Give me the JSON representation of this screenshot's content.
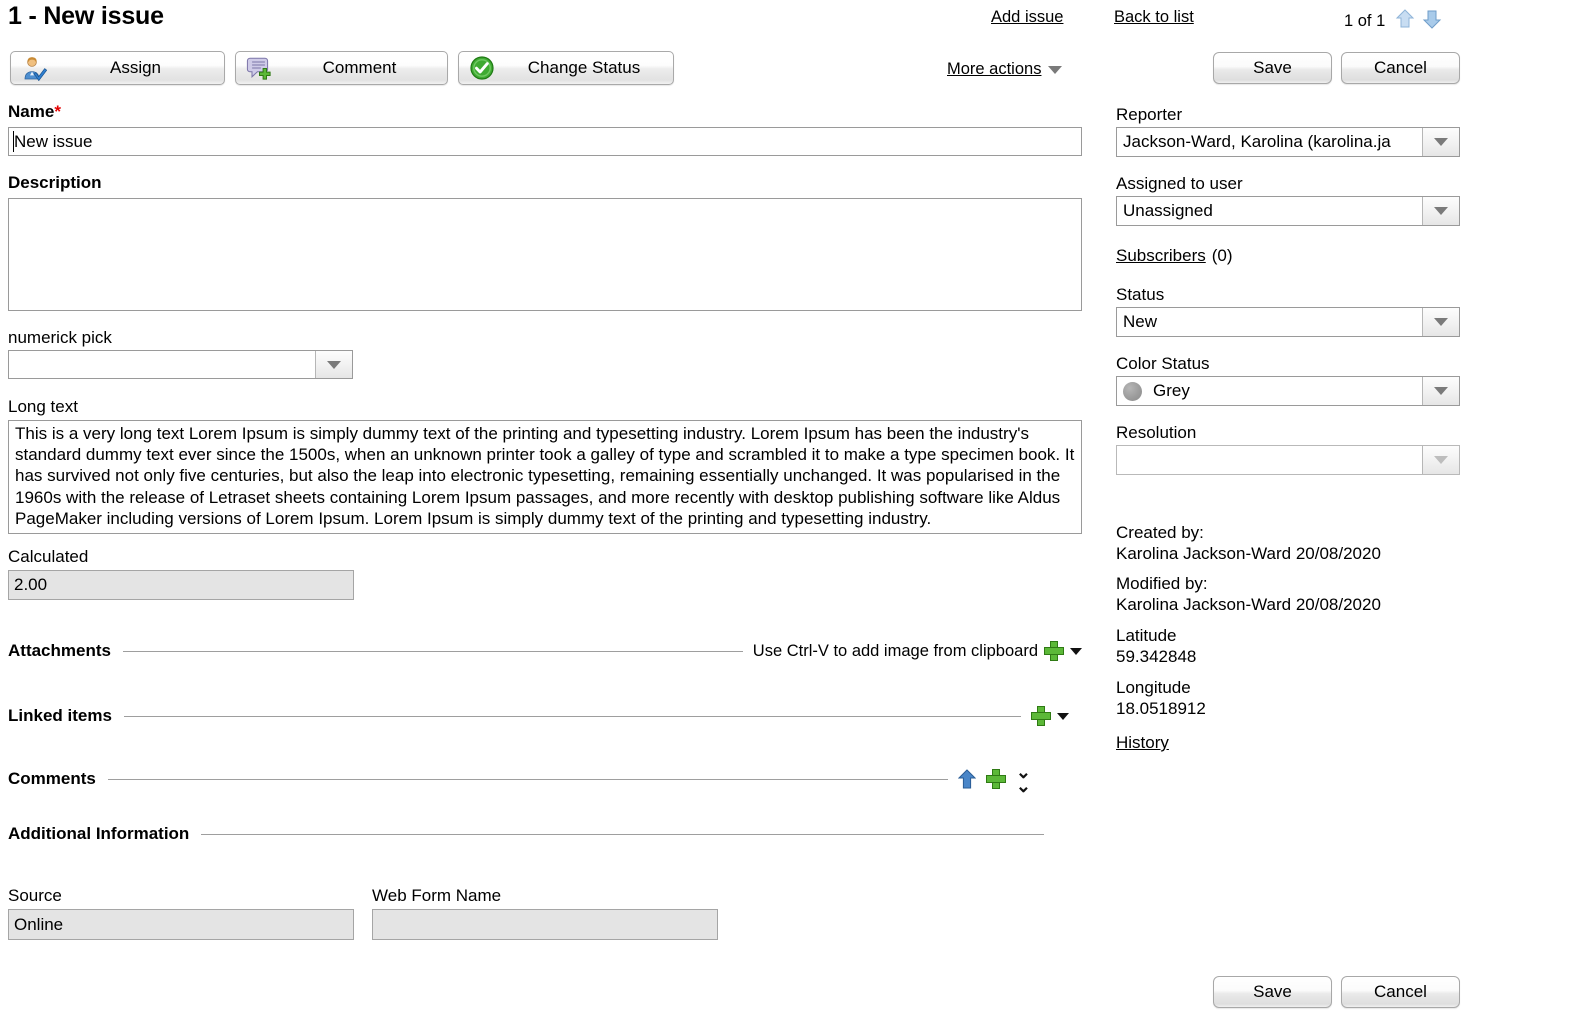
{
  "header": {
    "title": "1 - New issue",
    "add_issue": "Add issue",
    "back_to_list": "Back to list",
    "pager_count": "1 of 1",
    "more_actions": "More actions"
  },
  "toolbar": {
    "assign": "Assign",
    "comment": "Comment",
    "change_status": "Change Status",
    "save": "Save",
    "cancel": "Cancel"
  },
  "footer": {
    "save": "Save",
    "cancel": "Cancel"
  },
  "form": {
    "name_label": "Name",
    "name_required": "*",
    "name_value": "New issue",
    "description_label": "Description",
    "description_value": "",
    "description_placeholder": "",
    "numerick_label": "numerick pick",
    "numerick_value": "",
    "longtext_label": "Long text",
    "longtext_value": "This is a very long text Lorem Ipsum is simply dummy text of the printing and typesetting industry. Lorem Ipsum has been the industry's standard dummy text ever since the 1500s, when an unknown printer took a galley of type and scrambled it to make a type specimen book. It has survived not only five centuries, but also the leap into electronic typesetting, remaining essentially unchanged. It was popularised in the 1960s with the release of Letraset sheets containing Lorem Ipsum passages, and more recently with desktop publishing software like Aldus PageMaker including versions of Lorem Ipsum. Lorem Ipsum is simply dummy text of the printing and typesetting industry.",
    "calculated_label": "Calculated",
    "calculated_value": "2.00"
  },
  "sections": {
    "attachments": "Attachments",
    "attachments_hint": "Use Ctrl-V to add image from clipboard",
    "linked_items": "Linked items",
    "comments": "Comments",
    "additional_information": "Additional Information"
  },
  "additional": {
    "source_label": "Source",
    "source_value": "Online",
    "webform_label": "Web Form Name",
    "webform_value": ""
  },
  "sidebar": {
    "reporter_label": "Reporter",
    "reporter_value": "Jackson-Ward, Karolina (karolina.ja",
    "assigned_label": "Assigned to user",
    "assigned_value": "Unassigned",
    "subscribers_label": "Subscribers",
    "subscribers_count": "(0)",
    "status_label": "Status",
    "status_value": "New",
    "color_status_label": "Color Status",
    "color_status_value": "Grey",
    "color_status_hex": "#9c9c9c",
    "resolution_label": "Resolution",
    "resolution_value": "",
    "created_by_label": "Created by:",
    "created_by_value": "Karolina Jackson-Ward 20/08/2020",
    "modified_by_label": "Modified by:",
    "modified_by_value": "Karolina Jackson-Ward 20/08/2020",
    "latitude_label": "Latitude",
    "latitude_value": "59.342848",
    "longitude_label": "Longitude",
    "longitude_value": "18.0518912",
    "history_link": "History"
  },
  "icons": {
    "assign": "assign-user-icon",
    "comment": "comment-add-icon",
    "change_status": "check-circle-icon",
    "pager_prev": "arrow-up-icon",
    "pager_next": "arrow-down-icon",
    "add": "plus-icon",
    "dropdown": "chevron-down-icon",
    "expand_all": "double-chevron-down-icon",
    "upload": "arrow-up-blue-icon"
  },
  "colors": {
    "accent_green": "#5cb838",
    "accent_blue": "#4a86c8",
    "required_red": "#e40000"
  }
}
